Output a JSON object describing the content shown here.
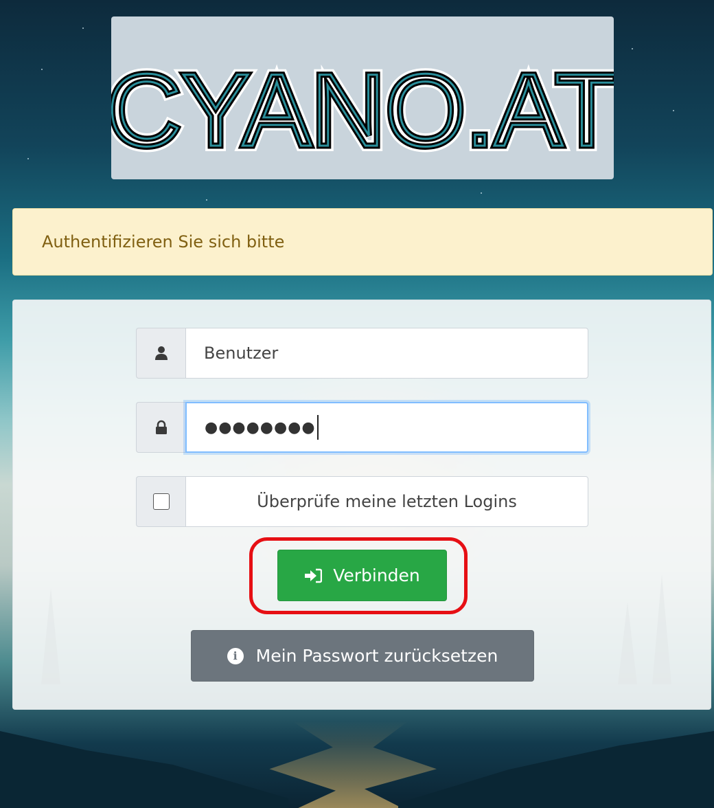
{
  "logo": {
    "text": "CYANO.AT"
  },
  "alert": {
    "message": "Authentifizieren Sie sich bitte"
  },
  "login": {
    "username_value": "Benutzer",
    "password_masked": "●●●●●●●●",
    "check_logins_label": "Überprüfe meine letzten Logins",
    "connect_label": "Verbinden",
    "reset_label": "Mein Passwort zurücksetzen"
  },
  "icons": {
    "user": "user-icon",
    "lock": "lock-icon",
    "sign_in": "sign-in-icon",
    "info": "info-icon"
  },
  "colors": {
    "alert_bg": "#fcf1cd",
    "alert_text": "#806012",
    "connect_bg": "#28a745",
    "reset_bg": "#6c757d",
    "highlight": "#e60f14",
    "focus_border": "#80bdff"
  }
}
